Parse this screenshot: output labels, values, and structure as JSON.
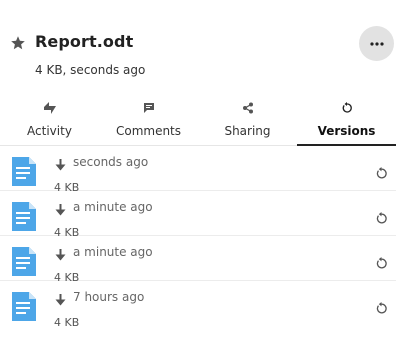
{
  "file": {
    "name": "Report.odt",
    "meta": "4 KB, seconds ago"
  },
  "tabs": [
    {
      "label": "Activity",
      "icon": "activity-icon"
    },
    {
      "label": "Comments",
      "icon": "comment-icon"
    },
    {
      "label": "Sharing",
      "icon": "share-icon"
    },
    {
      "label": "Versions",
      "icon": "restore-icon",
      "active": true
    }
  ],
  "versions": [
    {
      "time": "seconds ago",
      "size": "4 KB"
    },
    {
      "time": "a minute ago",
      "size": "4 KB"
    },
    {
      "time": "a minute ago",
      "size": "4 KB"
    },
    {
      "time": "7 hours ago",
      "size": "4 KB"
    }
  ],
  "colors": {
    "file_icon": "#4da6e8",
    "accent_underline": "#222222",
    "more_button_bg": "#e2e2e2"
  }
}
